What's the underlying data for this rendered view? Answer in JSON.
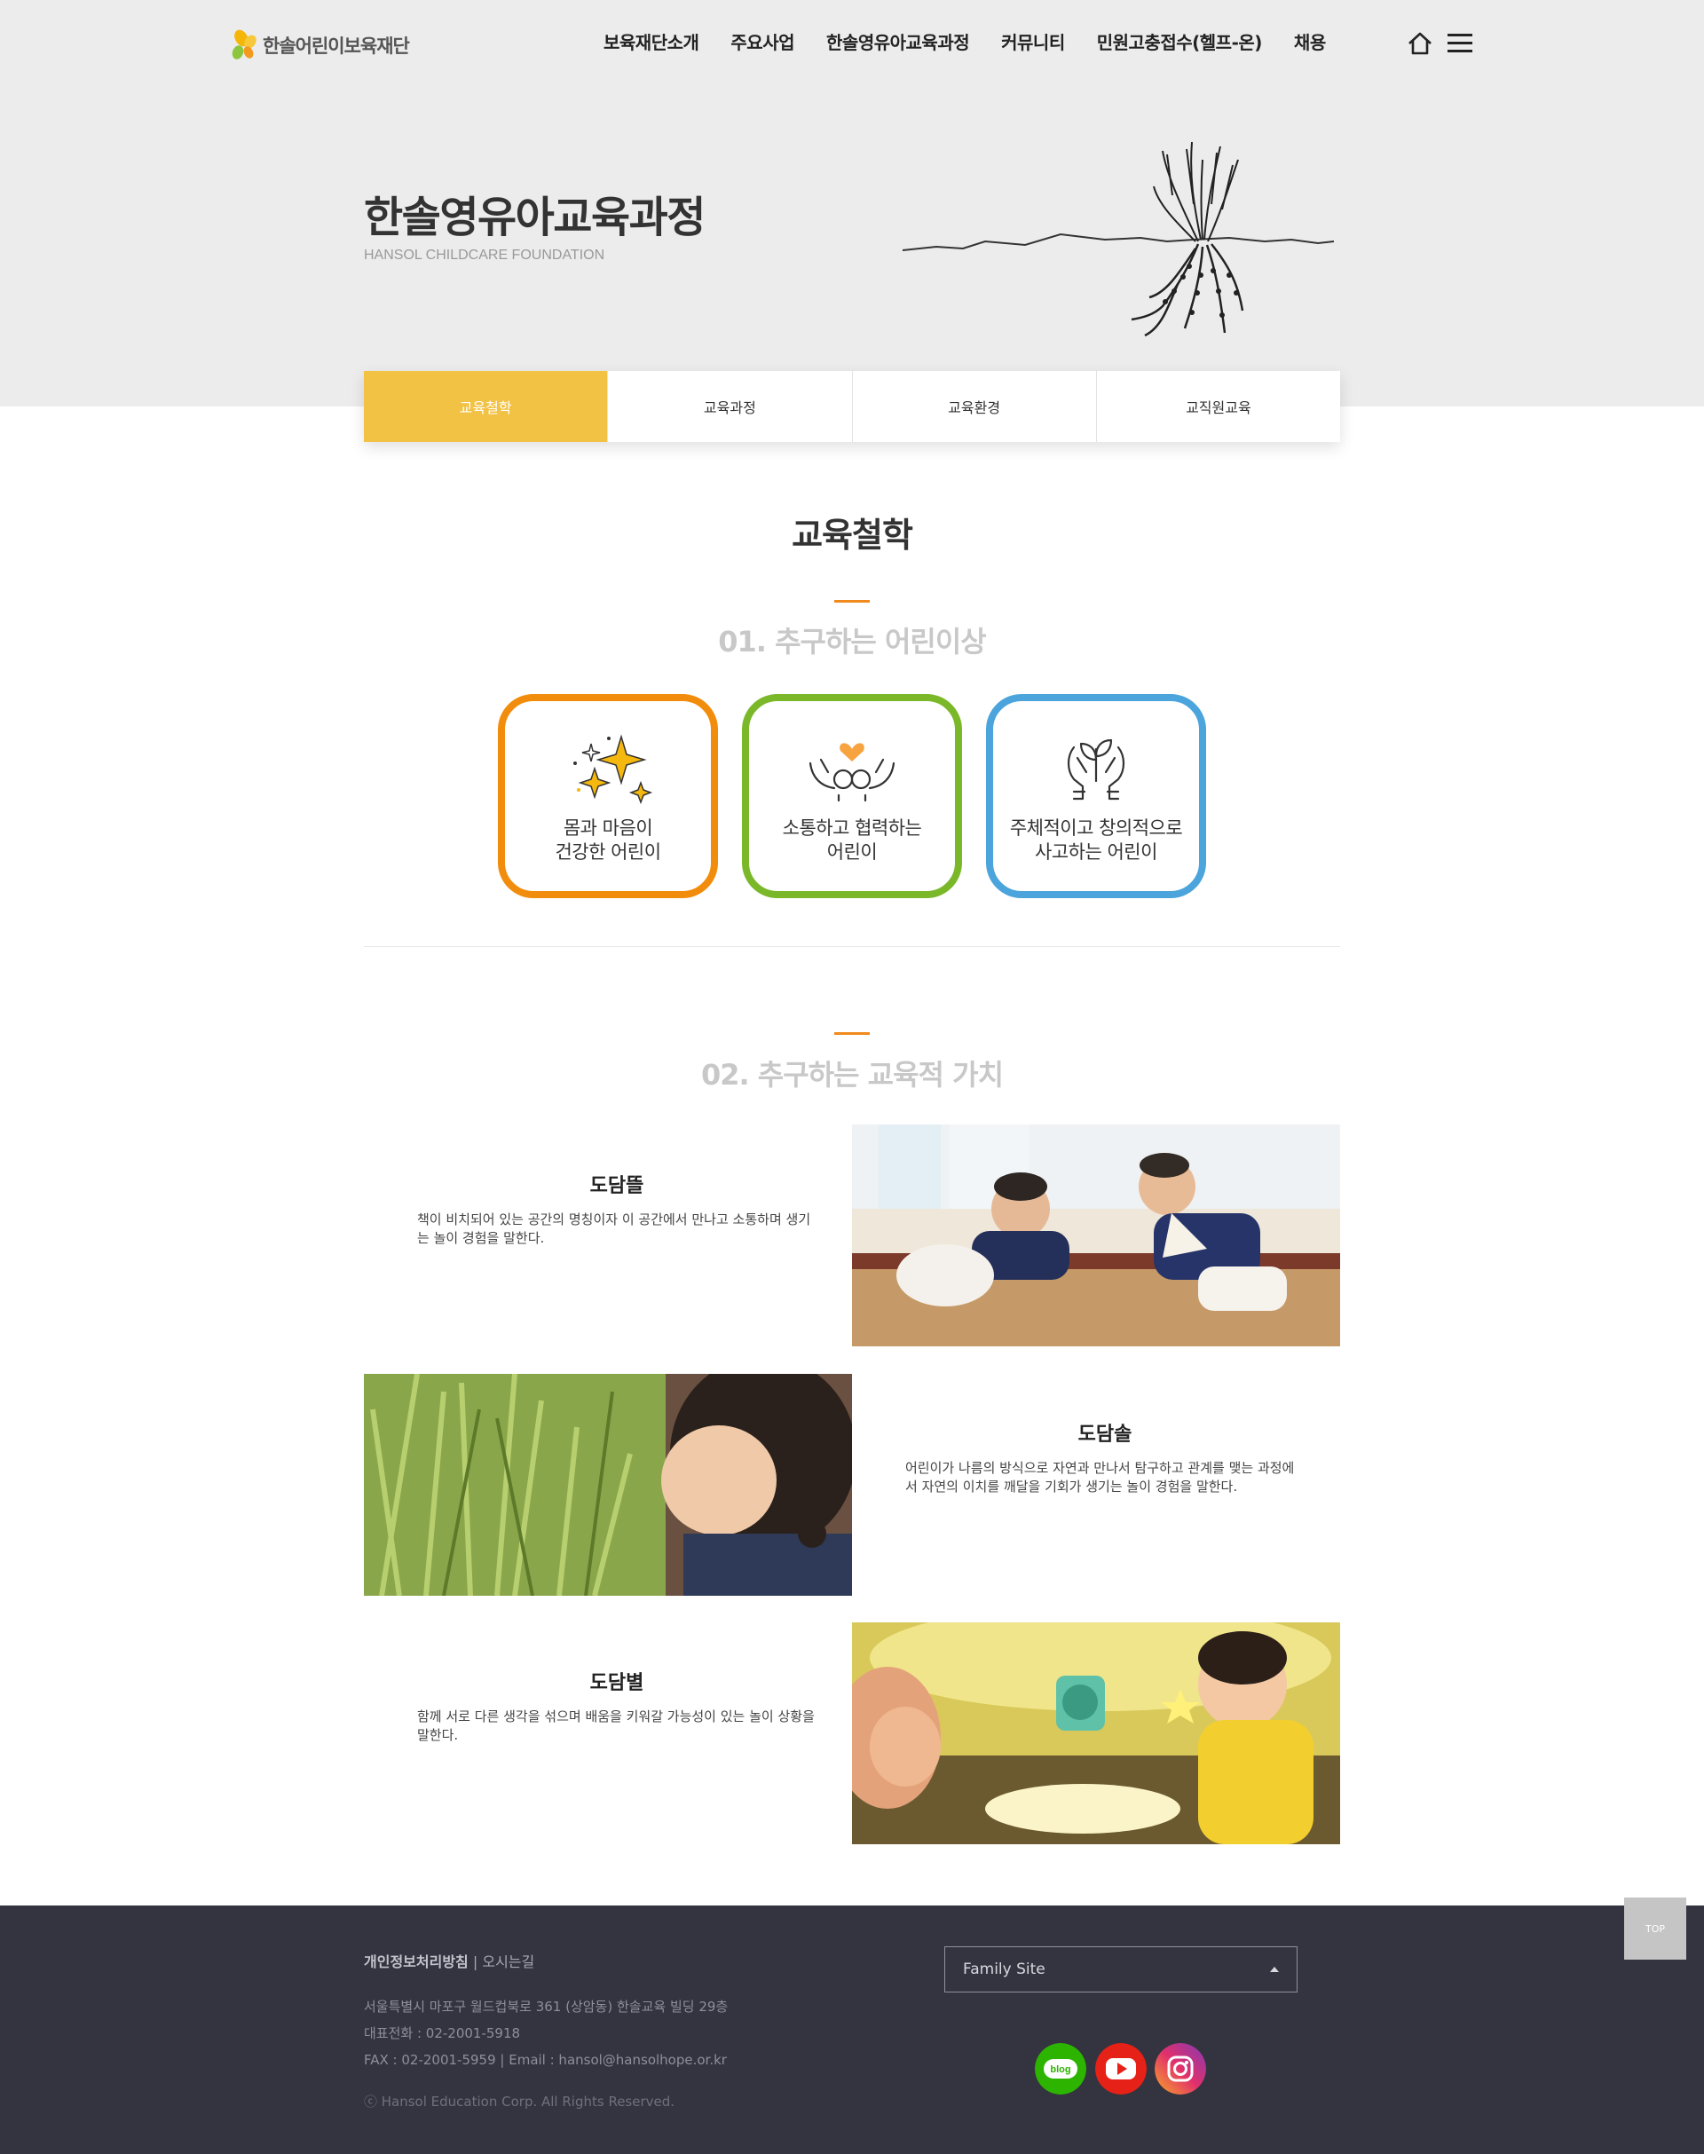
{
  "header": {
    "logo_text": "한솔어린이보육재단",
    "nav": [
      "보육재단소개",
      "주요사업",
      "한솔영유아교육과정",
      "커뮤니티",
      "민원고충접수(헬프-온)",
      "채용"
    ]
  },
  "hero": {
    "title": "한솔영유아교육과정",
    "subtitle": "HANSOL CHILDCARE FOUNDATION"
  },
  "tabs": [
    {
      "label": "교육철학",
      "active": true
    },
    {
      "label": "교육과정",
      "active": false
    },
    {
      "label": "교육환경",
      "active": false
    },
    {
      "label": "교직원교육",
      "active": false
    }
  ],
  "main": {
    "heading": "교육철학",
    "section1_title": "01. 추구하는 어린이상",
    "ideals": [
      {
        "line1": "몸과 마음이",
        "line2": "건강한 어린이",
        "color": "#f28c0c",
        "icon": "sparkles-icon"
      },
      {
        "line1": "소통하고 협력하는",
        "line2": "어린이",
        "color": "#7ab82a",
        "icon": "hands-heart-icon"
      },
      {
        "line1": "주체적이고 창의적으로",
        "line2": "사고하는 어린이",
        "color": "#4ba4dc",
        "icon": "hands-sprout-icon"
      }
    ],
    "section2_title": "02. 추구하는 교육적 가치",
    "values": [
      {
        "title": "도담뜰",
        "desc": "책이 비치되어 있는 공간의 명칭이자 이 공간에서 만나고 소통하며 생기는 놀이 경험을 말한다."
      },
      {
        "title": "도담솔",
        "desc": "어린이가 나름의 방식으로 자연과 만나서 탐구하고 관계를 맺는 과정에서 자연의 이치를 깨달을 기회가 생기는 놀이 경험을 말한다."
      },
      {
        "title": "도담별",
        "desc": "함께 서로 다른 생각을 섞으며 배움을 키워갈 가능성이 있는 놀이 상황을 말한다."
      }
    ]
  },
  "footer": {
    "privacy": "개인정보처리방침",
    "separator": "|",
    "directions": "오시는길",
    "address": "서울특별시 마포구 월드컵북로 361 (상암동) 한솔교육 빌딩 29층",
    "tel": "대표전화 : 02-2001-5918",
    "fax_email": "FAX : 02-2001-5959  |  Email : hansol@hansolhope.or.kr",
    "copyright": "ⓒ Hansol Education Corp. All Rights Reserved.",
    "family_site": "Family Site",
    "top_label": "TOP",
    "sns": {
      "blog": "blog"
    }
  },
  "colors": {
    "accent": "#f2c244",
    "orange": "#f28c0c",
    "green": "#7ab82a",
    "blue": "#4ba4dc",
    "footer_bg": "#333440"
  }
}
